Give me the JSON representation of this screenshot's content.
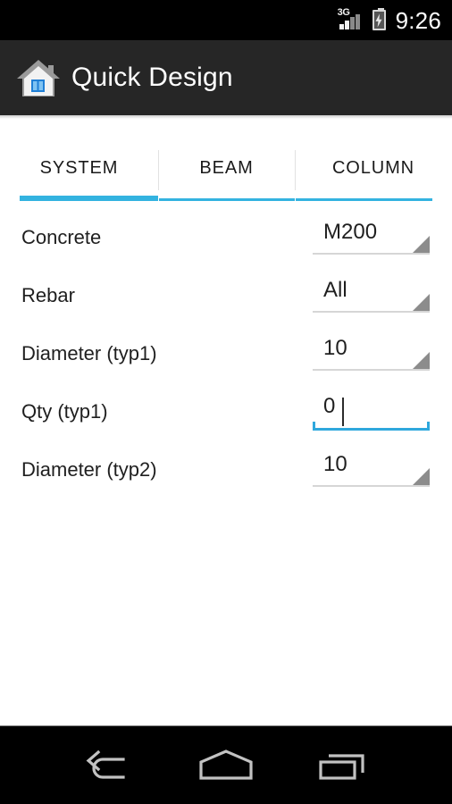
{
  "status_bar": {
    "network_label": "3G",
    "signal_icon": "signal-bars-icon",
    "battery_icon": "battery-charging-icon",
    "clock": "9:26"
  },
  "action_bar": {
    "icon": "home-house-icon",
    "title": "Quick Design",
    "background": "#262626"
  },
  "tabs": {
    "active_index": 0,
    "accent_color": "#33b3e0",
    "items": [
      {
        "label": "SYSTEM"
      },
      {
        "label": "BEAM"
      },
      {
        "label": "COLUMN"
      }
    ]
  },
  "form": {
    "rows": [
      {
        "label": "Concrete",
        "type": "spinner",
        "value": "M200",
        "dropdown_icon": "triangle-down-icon"
      },
      {
        "label": "Rebar",
        "type": "spinner",
        "value": "All",
        "dropdown_icon": "triangle-down-icon"
      },
      {
        "label": "Diameter (typ1)",
        "type": "spinner",
        "value": "10",
        "dropdown_icon": "triangle-down-icon"
      },
      {
        "label": "Qty (typ1)",
        "type": "edit",
        "value": "0",
        "focused": true,
        "focus_color": "#2fa8dd"
      },
      {
        "label": "Diameter (typ2)",
        "type": "spinner",
        "value": "10",
        "dropdown_icon": "triangle-down-icon"
      }
    ]
  },
  "nav_bar": {
    "buttons": [
      {
        "name": "back-icon"
      },
      {
        "name": "home-icon"
      },
      {
        "name": "recents-icon"
      }
    ]
  }
}
